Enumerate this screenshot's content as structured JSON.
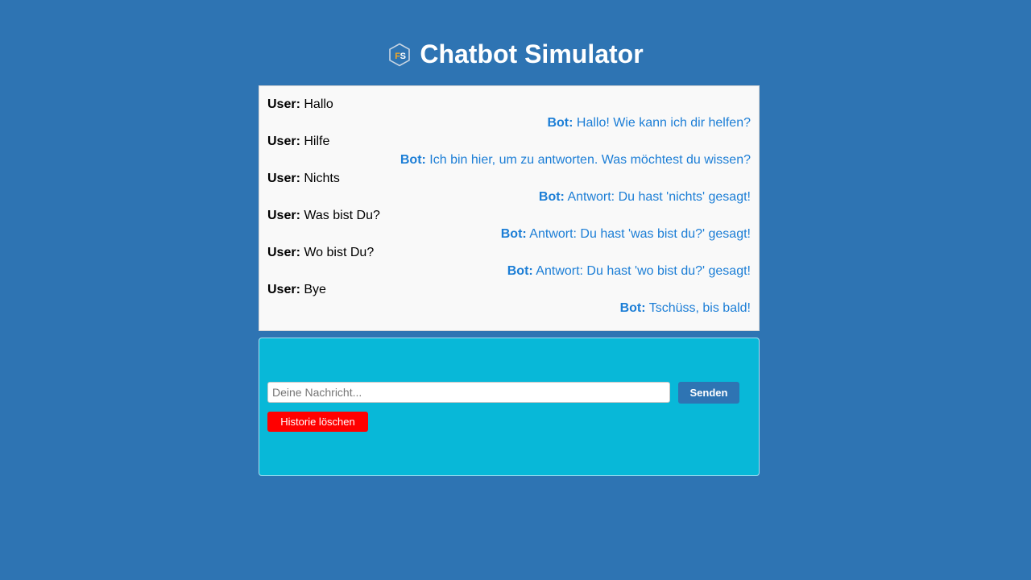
{
  "header": {
    "logo_icon": "fs-hexagon-logo",
    "logo_text": "FS",
    "title": "Chatbot Simulator"
  },
  "chat": {
    "messages": [
      {
        "role": "user",
        "speaker": "User:",
        "text": "Hallo"
      },
      {
        "role": "bot",
        "speaker": "Bot:",
        "text": "Hallo! Wie kann ich dir helfen?"
      },
      {
        "role": "user",
        "speaker": "User:",
        "text": "Hilfe"
      },
      {
        "role": "bot",
        "speaker": "Bot:",
        "text": "Ich bin hier, um zu antworten. Was möchtest du wissen?"
      },
      {
        "role": "user",
        "speaker": "User:",
        "text": "Nichts"
      },
      {
        "role": "bot",
        "speaker": "Bot:",
        "text": "Antwort: Du hast 'nichts' gesagt!"
      },
      {
        "role": "user",
        "speaker": "User:",
        "text": "Was bist Du?"
      },
      {
        "role": "bot",
        "speaker": "Bot:",
        "text": "Antwort: Du hast 'was bist du?' gesagt!"
      },
      {
        "role": "user",
        "speaker": "User:",
        "text": "Wo bist Du?"
      },
      {
        "role": "bot",
        "speaker": "Bot:",
        "text": "Antwort: Du hast 'wo bist du?' gesagt!"
      },
      {
        "role": "user",
        "speaker": "User:",
        "text": "Bye"
      },
      {
        "role": "bot",
        "speaker": "Bot:",
        "text": "Tschüss, bis bald!"
      }
    ]
  },
  "controls": {
    "input_value": "",
    "input_placeholder": "Deine Nachricht...",
    "send_label": "Senden",
    "clear_label": "Historie löschen"
  },
  "colors": {
    "background": "#2e74b3",
    "bot_text": "#1c7ed6",
    "controls_panel": "#08b8d8",
    "send_button": "#2e74b3",
    "clear_button": "#ff0000"
  }
}
